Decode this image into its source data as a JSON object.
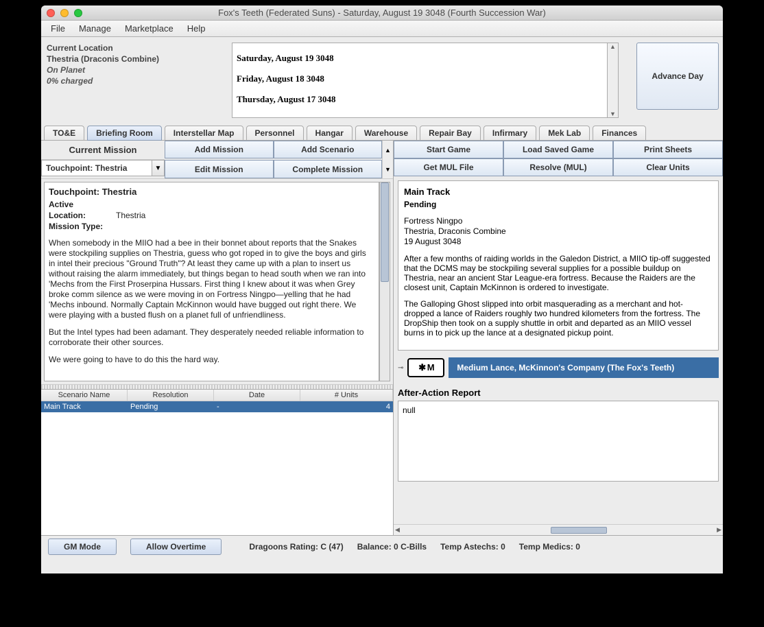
{
  "window": {
    "title": "Fox's Teeth (Federated Suns) - Saturday, August 19 3048 (Fourth Succession War)"
  },
  "menu": {
    "file": "File",
    "manage": "Manage",
    "marketplace": "Marketplace",
    "help": "Help"
  },
  "location": {
    "label": "Current Location",
    "value": "Thestria (Draconis Combine)",
    "status": "On Planet",
    "charge": "0% charged"
  },
  "dates": {
    "d1": "Saturday, August 19 3048",
    "d2": "Friday, August 18 3048",
    "d3": "Thursday, August 17 3048"
  },
  "advance": "Advance Day",
  "tabs": {
    "toe": "TO&E",
    "briefing": "Briefing Room",
    "map": "Interstellar Map",
    "personnel": "Personnel",
    "hangar": "Hangar",
    "warehouse": "Warehouse",
    "repair": "Repair Bay",
    "infirmary": "Infirmary",
    "meklab": "Mek Lab",
    "finances": "Finances"
  },
  "mission_header": "Current Mission",
  "mission_select": "Touchpoint: Thestria",
  "btns": {
    "add_mission": "Add Mission",
    "add_scenario": "Add Scenario",
    "edit_mission": "Edit Mission",
    "complete_mission": "Complete Mission"
  },
  "rightbtns": {
    "start": "Start Game",
    "load": "Load Saved Game",
    "print": "Print Sheets",
    "mul": "Get MUL File",
    "resolve": "Resolve (MUL)",
    "clear": "Clear Units"
  },
  "briefing": {
    "title": "Touchpoint: Thestria",
    "status": "Active",
    "loc_label": "Location:",
    "loc_value": "Thestria",
    "type_label": "Mission Type:",
    "p1": "When somebody in the MIIO had a bee in their bonnet about reports that the Snakes were stockpiling supplies on Thestria, guess who got roped in to give the boys and girls in intel their precious \"Ground Truth\"? At least they came up with a plan to insert us without raising the alarm immediately, but things began to head south when we ran into 'Mechs from the First Proserpina Hussars. First thing I knew about it was when Grey broke comm silence as we were moving in on Fortress Ningpo—yelling that he had 'Mechs inbound. Normally Captain McKinnon would have bugged out right there. We were playing with a busted flush on a planet full of unfriendliness.",
    "p2": "But the Intel types had been adamant. They desperately needed reliable information to corroborate their other sources.",
    "p3": "We were going to have to do this the hard way."
  },
  "scen_table": {
    "h1": "Scenario Name",
    "h2": "Resolution",
    "h3": "Date",
    "h4": "# Units",
    "r1c1": "Main Track",
    "r1c2": "Pending",
    "r1c3": "-",
    "r1c4": "4"
  },
  "track": {
    "title": "Main Track",
    "status": "Pending",
    "m1": "Fortress Ningpo",
    "m2": "Thestria, Draconis Combine",
    "m3": "19 August 3048",
    "p1": "After a few months of raiding worlds in the Galedon District, a MIIO tip-off suggested that the DCMS may be stockpiling several supplies for a possible buildup on Thestria, near an ancient Star League-era fortress. Because the Raiders are the closest unit, Captain McKinnon is ordered to investigate.",
    "p2": "The Galloping Ghost slipped into orbit masquerading as a merchant and hot-dropped a lance of Raiders roughly two hundred kilometers from the fortress. The DropShip then took on a supply shuttle in orbit and departed as an MIIO vessel burns in to pick up the lance at a designated pickup point."
  },
  "lance": {
    "icon": "✱ M",
    "label": "Medium Lance, McKinnon's Company (The Fox's Teeth)"
  },
  "aar": {
    "label": "After-Action Report",
    "value": "null"
  },
  "status": {
    "gm": "GM Mode",
    "overtime": "Allow Overtime",
    "dragoons": "Dragoons Rating: C (47)",
    "balance": "Balance: 0 C-Bills",
    "astechs": "Temp Astechs: 0",
    "medics": "Temp Medics: 0"
  }
}
